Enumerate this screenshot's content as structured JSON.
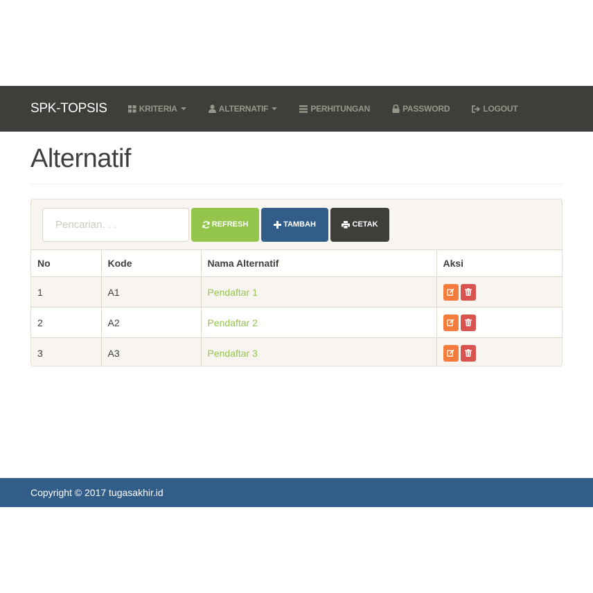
{
  "navbar": {
    "brand": "SPK-TOPSIS",
    "items": [
      {
        "label": "KRITERIA",
        "icon": "grid-icon",
        "dropdown": true
      },
      {
        "label": "ALTERNATIF",
        "icon": "user-icon",
        "dropdown": true
      },
      {
        "label": "PERHITUNGAN",
        "icon": "list-icon",
        "dropdown": false
      },
      {
        "label": "PASSWORD",
        "icon": "lock-icon",
        "dropdown": false
      },
      {
        "label": "LOGOUT",
        "icon": "logout-icon",
        "dropdown": false
      }
    ]
  },
  "page": {
    "title": "Alternatif"
  },
  "toolbar": {
    "search_placeholder": "Pencarian. . .",
    "search_value": "",
    "refresh_label": "REFRESH",
    "tambah_label": "TAMBAH",
    "cetak_label": "CETAK"
  },
  "table": {
    "headers": [
      "No",
      "Kode",
      "Nama Alternatif",
      "Aksi"
    ],
    "rows": [
      {
        "no": "1",
        "kode": "A1",
        "nama": "Pendaftar 1"
      },
      {
        "no": "2",
        "kode": "A2",
        "nama": "Pendaftar 2"
      },
      {
        "no": "3",
        "kode": "A3",
        "nama": "Pendaftar 3"
      }
    ]
  },
  "footer": {
    "text": "Copyright © 2017 tugasakhir.id"
  },
  "colors": {
    "navbar": "#3e3f3a",
    "success": "#93c54b",
    "primary": "#325d88",
    "dark": "#3e3f3a",
    "warning": "#f47c3c",
    "danger": "#d9534f",
    "panel_bg": "#f8f5f0"
  }
}
